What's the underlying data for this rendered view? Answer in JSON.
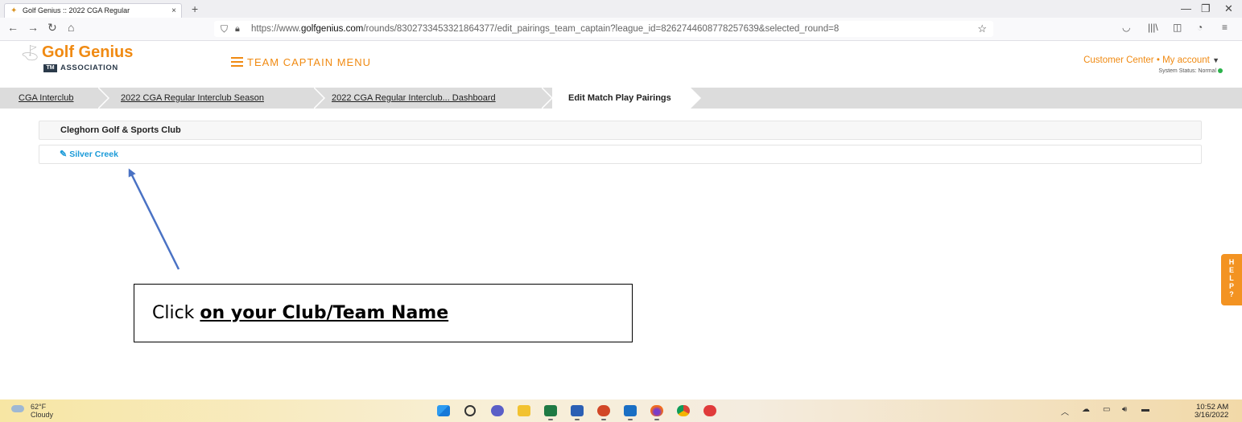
{
  "browser": {
    "tab_title": "Golf Genius :: 2022 CGA Regular",
    "tab_close": "×",
    "new_tab": "+",
    "url_prefix": "https://www.",
    "url_domain": "golfgenius.com",
    "url_path": "/rounds/8302733453321864377/edit_pairings_team_captain?league_id=8262744608778257639&selected_round=8"
  },
  "header": {
    "logo_name": "Golf Genius",
    "logo_tm": "TM",
    "logo_assoc": "ASSOCIATION",
    "menu_label": "TEAM CAPTAIN MENU",
    "customer_center": "Customer Center",
    "bullet": "•",
    "my_account": "My account",
    "system_status": "System Status: Normal"
  },
  "breadcrumb": {
    "items": [
      {
        "label": "CGA Interclub"
      },
      {
        "label": "2022 CGA Regular Interclub Season"
      },
      {
        "label": "2022 CGA Regular Interclub... Dashboard"
      },
      {
        "label": "Edit Match Play Pairings"
      }
    ]
  },
  "main": {
    "club_name": "Cleghorn Golf & Sports Club",
    "team_link": "Silver Creek"
  },
  "annotation": {
    "callout_prefix": "Click ",
    "callout_emphasis": "on your Club/Team Name"
  },
  "help": {
    "letters": [
      "H",
      "E",
      "L",
      "P",
      "?"
    ]
  },
  "taskbar": {
    "weather_temp": "62°F",
    "weather_desc": "Cloudy",
    "time": "10:52 AM",
    "date": "3/16/2022"
  },
  "colors": {
    "brand_orange": "#f08a12",
    "link_blue": "#1a9ad8",
    "annotation_arrow": "#4a72c4"
  }
}
